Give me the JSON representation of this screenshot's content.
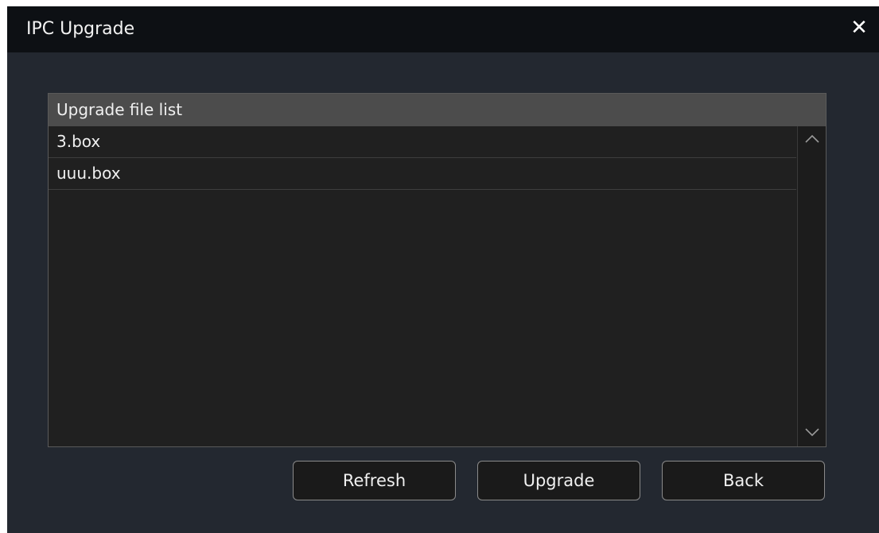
{
  "window": {
    "title": "IPC Upgrade",
    "close_icon": "close-icon"
  },
  "file_list": {
    "header": "Upgrade file list",
    "items": [
      {
        "name": "3.box"
      },
      {
        "name": "uuu.box"
      }
    ],
    "scroll_up_icon": "chevron-up-icon",
    "scroll_down_icon": "chevron-down-icon"
  },
  "buttons": {
    "refresh": "Refresh",
    "upgrade": "Upgrade",
    "back": "Back"
  },
  "colors": {
    "titlebar": "#0d1014",
    "dialog_bg": "#232830",
    "list_bg": "#202020",
    "header_bg": "#4c4c4c",
    "text": "#f0f0f0"
  }
}
